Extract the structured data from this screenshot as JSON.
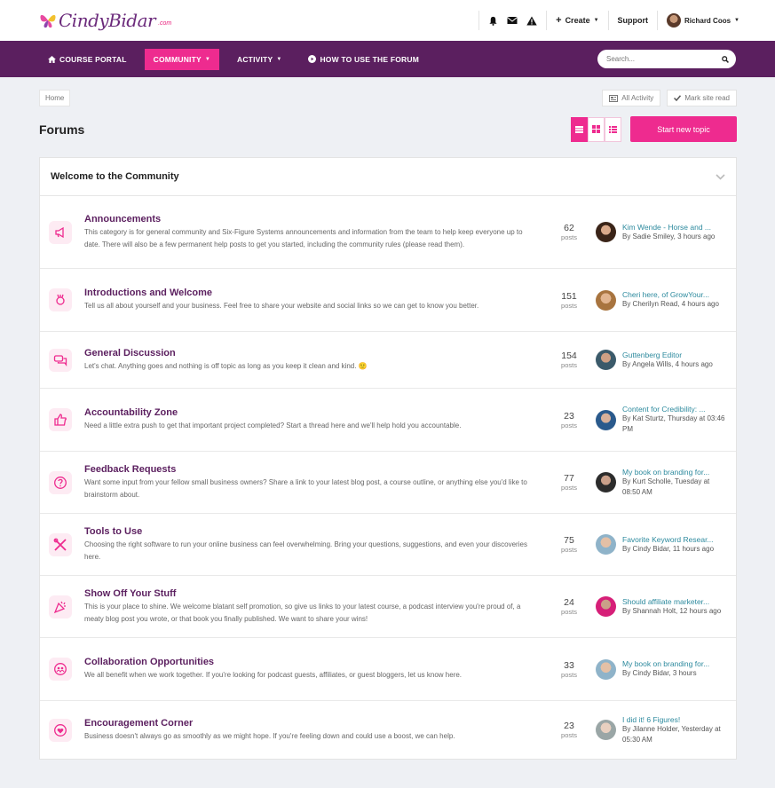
{
  "brand": {
    "name": "CindyBidar",
    "suffix": ".com",
    "pink": "#ee2b8f",
    "purple": "#5b1f5f"
  },
  "topbar": {
    "create_label": "Create",
    "support_label": "Support",
    "user_name": "Richard Coos"
  },
  "nav": {
    "items": [
      {
        "label": "COURSE PORTAL",
        "icon": "home-icon"
      },
      {
        "label": "COMMUNITY",
        "icon": "caret-down-icon"
      },
      {
        "label": "ACTIVITY",
        "icon": "caret-down-icon"
      },
      {
        "label": "HOW TO USE THE FORUM",
        "icon": "play-circle-icon"
      }
    ],
    "search_placeholder": "Search..."
  },
  "breadcrumb": {
    "home": "Home"
  },
  "actions": {
    "all_activity": "All Activity",
    "mark_read": "Mark site read"
  },
  "page": {
    "title": "Forums",
    "start_topic": "Start new topic"
  },
  "category": {
    "title": "Welcome to the Community"
  },
  "forums": [
    {
      "title": "Announcements",
      "desc": "This category is for general community and Six-Figure Systems announcements and information from the team to help keep everyone up to date. There will also be a few permanent help posts to get you started, including the community rules (please read them).",
      "posts": "62",
      "posts_label": "posts",
      "last_title": "Kim Wende - Horse and ...",
      "last_meta": "By Sadie Smiley, 3 hours ago",
      "icon": "megaphone-icon"
    },
    {
      "title": "Introductions and Welcome",
      "desc": "Tell us all about yourself and your business. Feel free to share your website and social links so we can get to know you better.",
      "posts": "151",
      "posts_label": "posts",
      "last_title": "Cheri here, of GrowYour...",
      "last_meta": "By Cherilyn Read, 4 hours ago",
      "icon": "waving-hand-icon"
    },
    {
      "title": "General Discussion",
      "desc": "Let's chat. Anything goes and nothing is off topic as long as you keep it clean and kind. 🙂",
      "posts": "154",
      "posts_label": "posts",
      "last_title": "Guttenberg Editor",
      "last_meta": "By Angela Wills, 4 hours ago",
      "icon": "chat-bubbles-icon"
    },
    {
      "title": "Accountability Zone",
      "desc": "Need a little extra push to get that important project completed? Start a thread here and we'll help hold you accountable.",
      "posts": "23",
      "posts_label": "posts",
      "last_title": "Content for Credibility: ...",
      "last_meta": "By Kat Sturtz, Thursday at 03:46 PM",
      "icon": "thumbs-up-icon"
    },
    {
      "title": "Feedback Requests",
      "desc": "Want some input from your fellow small business owners? Share a link to your latest blog post, a course outline, or anything else you'd like to brainstorm about.",
      "posts": "77",
      "posts_label": "posts",
      "last_title": "My book on branding for...",
      "last_meta": "By Kurt Scholle, Tuesday at 08:50 AM",
      "icon": "question-circle-icon"
    },
    {
      "title": "Tools to Use",
      "desc": "Choosing the right software to run your online business can feel overwhelming. Bring your questions, suggestions, and even your discoveries here.",
      "posts": "75",
      "posts_label": "posts",
      "last_title": "Favorite Keyword Resear...",
      "last_meta": "By Cindy Bidar, 11 hours ago",
      "icon": "tools-icon"
    },
    {
      "title": "Show Off Your Stuff",
      "desc": "This is your place to shine. We welcome blatant self promotion, so give us links to your latest course, a podcast interview you're proud of, a meaty blog post you wrote, or that book you finally published. We want to share your wins!",
      "posts": "24",
      "posts_label": "posts",
      "last_title": "Should affiliate marketer...",
      "last_meta": "By Shannah Holt, 12 hours ago",
      "icon": "party-popper-icon"
    },
    {
      "title": "Collaboration Opportunities",
      "desc": "We all benefit when we work together. If you're looking for podcast guests, affiliates, or guest bloggers, let us know here.",
      "posts": "33",
      "posts_label": "posts",
      "last_title": "My book on branding for...",
      "last_meta": "By Cindy Bidar, 3 hours",
      "icon": "people-circle-icon"
    },
    {
      "title": "Encouragement Corner",
      "desc": "Business doesn't always go as smoothly as we might hope. If you're feeling down and could use a boost, we can help.",
      "posts": "23",
      "posts_label": "posts",
      "last_title": "I did it! 6 Figures!",
      "last_meta": "By Jilanne Holder, Yesterday at 05:30 AM",
      "icon": "heart-circle-icon"
    }
  ]
}
